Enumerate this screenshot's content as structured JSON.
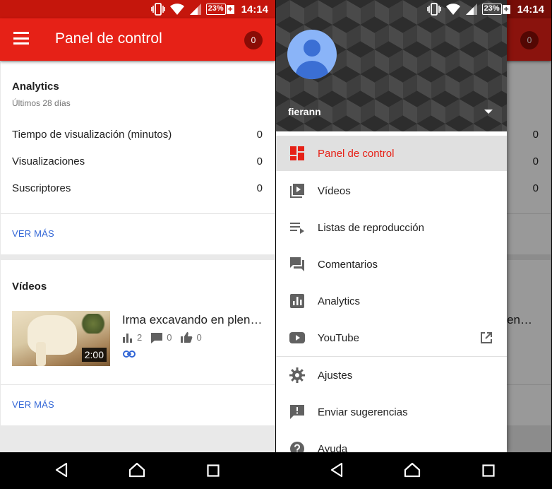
{
  "status": {
    "battery": "23%",
    "battery_plus": "+",
    "time": "14:14"
  },
  "app_bar": {
    "title": "Panel de control",
    "notification_count": "0"
  },
  "analytics": {
    "title": "Analytics",
    "subtitle": "Últimos 28 días",
    "rows": [
      {
        "label": "Tiempo de visualización (minutos)",
        "value": "0"
      },
      {
        "label": "Visualizaciones",
        "value": "0"
      },
      {
        "label": "Suscriptores",
        "value": "0"
      }
    ],
    "more": "VER MÁS"
  },
  "videos": {
    "title": "Vídeos",
    "items": [
      {
        "title": "Irma excavando en plen…",
        "duration": "2:00",
        "views": "2",
        "comments": "0",
        "likes": "0"
      }
    ],
    "more": "VER MÁS"
  },
  "drawer": {
    "username": "fierann",
    "items": [
      {
        "label": "Panel de control",
        "icon": "dashboard-icon",
        "active": true
      },
      {
        "label": "Vídeos",
        "icon": "video-library-icon"
      },
      {
        "label": "Listas de reproducción",
        "icon": "playlist-icon"
      },
      {
        "label": "Comentarios",
        "icon": "comments-icon"
      },
      {
        "label": "Analytics",
        "icon": "analytics-icon"
      },
      {
        "label": "YouTube",
        "icon": "youtube-icon",
        "external": true
      },
      {
        "label": "Ajustes",
        "icon": "settings-icon"
      },
      {
        "label": "Enviar sugerencias",
        "icon": "feedback-icon"
      },
      {
        "label": "Ayuda",
        "icon": "help-icon"
      }
    ]
  },
  "dimmed_background": {
    "values": [
      "0",
      "0",
      "0"
    ],
    "video_title_fragment": "plen…"
  },
  "colors": {
    "app_bar": "#e62117",
    "status_bar": "#c5160c",
    "link": "#3367d6",
    "active_item": "#e62117"
  }
}
